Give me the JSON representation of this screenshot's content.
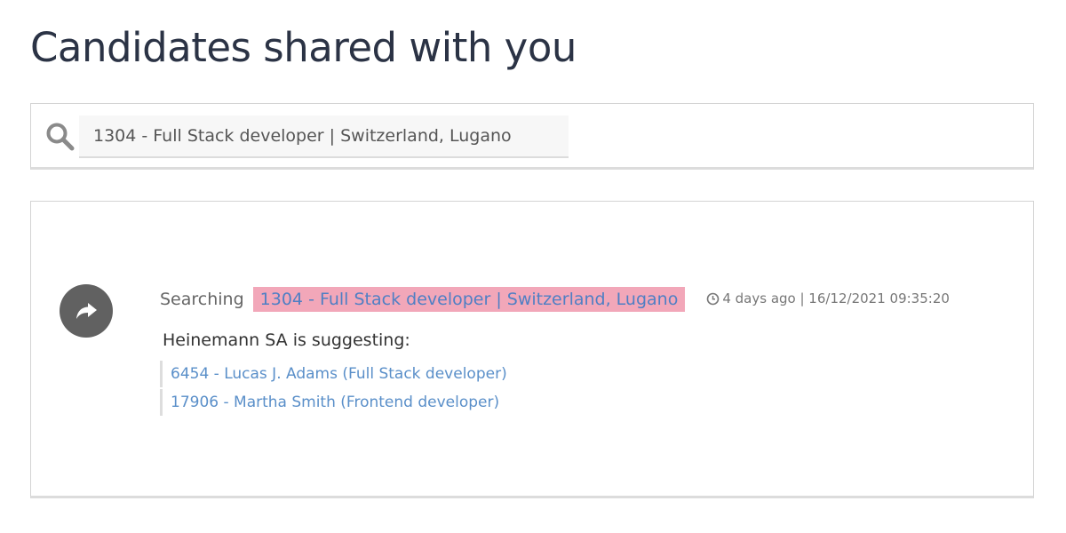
{
  "page": {
    "title": "Candidates shared with you"
  },
  "search": {
    "value": "1304 - Full Stack developer | Switzerland, Lugano",
    "icon": "search-icon"
  },
  "feed": {
    "item": {
      "icon": "share-arrow-icon",
      "searching_label": "Searching",
      "position_link": "1304 - Full Stack developer | Switzerland, Lugano",
      "time_icon": "clock-icon",
      "time_text": "4 days ago | 16/12/2021 09:35:20",
      "suggesting_text": "Heinemann SA is suggesting:",
      "candidates": [
        "6454 - Lucas J. Adams (Full Stack developer)",
        "17906 - Martha Smith (Frontend developer)"
      ]
    }
  },
  "colors": {
    "highlight": "#f2a7b9",
    "link": "#5a8fc9",
    "title": "#2b3345",
    "avatar": "#616161"
  }
}
